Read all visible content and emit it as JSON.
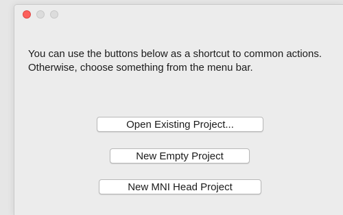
{
  "window": {
    "title": "",
    "controls": {
      "close_color": "#fc605c",
      "inactive_color": "#dcdcdc"
    }
  },
  "dialog": {
    "message": "You can use the buttons below as a shortcut to common actions. Otherwise, choose something from the menu bar."
  },
  "buttons": {
    "open_existing": "Open Existing Project...",
    "new_empty": "New Empty Project",
    "new_mni_head": "New MNI Head Project"
  }
}
